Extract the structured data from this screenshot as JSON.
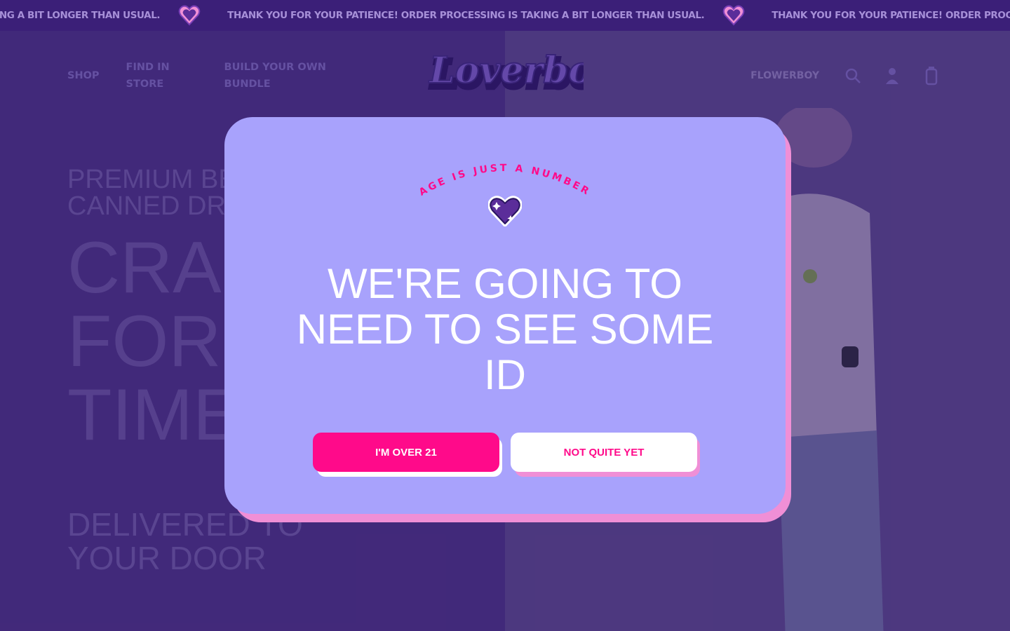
{
  "announcement": {
    "text": "THANK YOU FOR YOUR PATIENCE! ORDER PROCESSING IS TAKING A BIT LONGER THAN USUAL."
  },
  "header": {
    "nav": [
      {
        "label": "SHOP"
      },
      {
        "label": "FIND IN STORE"
      },
      {
        "label": "BUILD YOUR OWN BUNDLE"
      }
    ],
    "logo_text": "Loverboy",
    "flower_link": "FLOWERBOY",
    "icons": [
      "search-icon",
      "account-icon",
      "cart-icon"
    ]
  },
  "hero": {
    "subtitle": "PREMIUM BE... CANNED DR...",
    "subtitle_line1": "PREMIUM BE",
    "subtitle_line2": "CANNED DR",
    "title_line1": "CRA",
    "title_line2": "FOR",
    "title_line3": "TIME",
    "deliver_line1": "DELIVERED TO",
    "deliver_line2": "YOUR DOOR"
  },
  "modal": {
    "tagline": "AGE IS JUST A NUMBER",
    "title": "WE'RE GOING TO NEED TO SEE SOME ID",
    "confirm_label": "I'M OVER 21",
    "decline_label": "NOT QUITE YET"
  },
  "colors": {
    "brand_pink": "#ff0a8a",
    "modal_bg": "#a8a2fc",
    "announce_bg": "#3b1f78",
    "heart_purple": "#5b2d9a"
  }
}
